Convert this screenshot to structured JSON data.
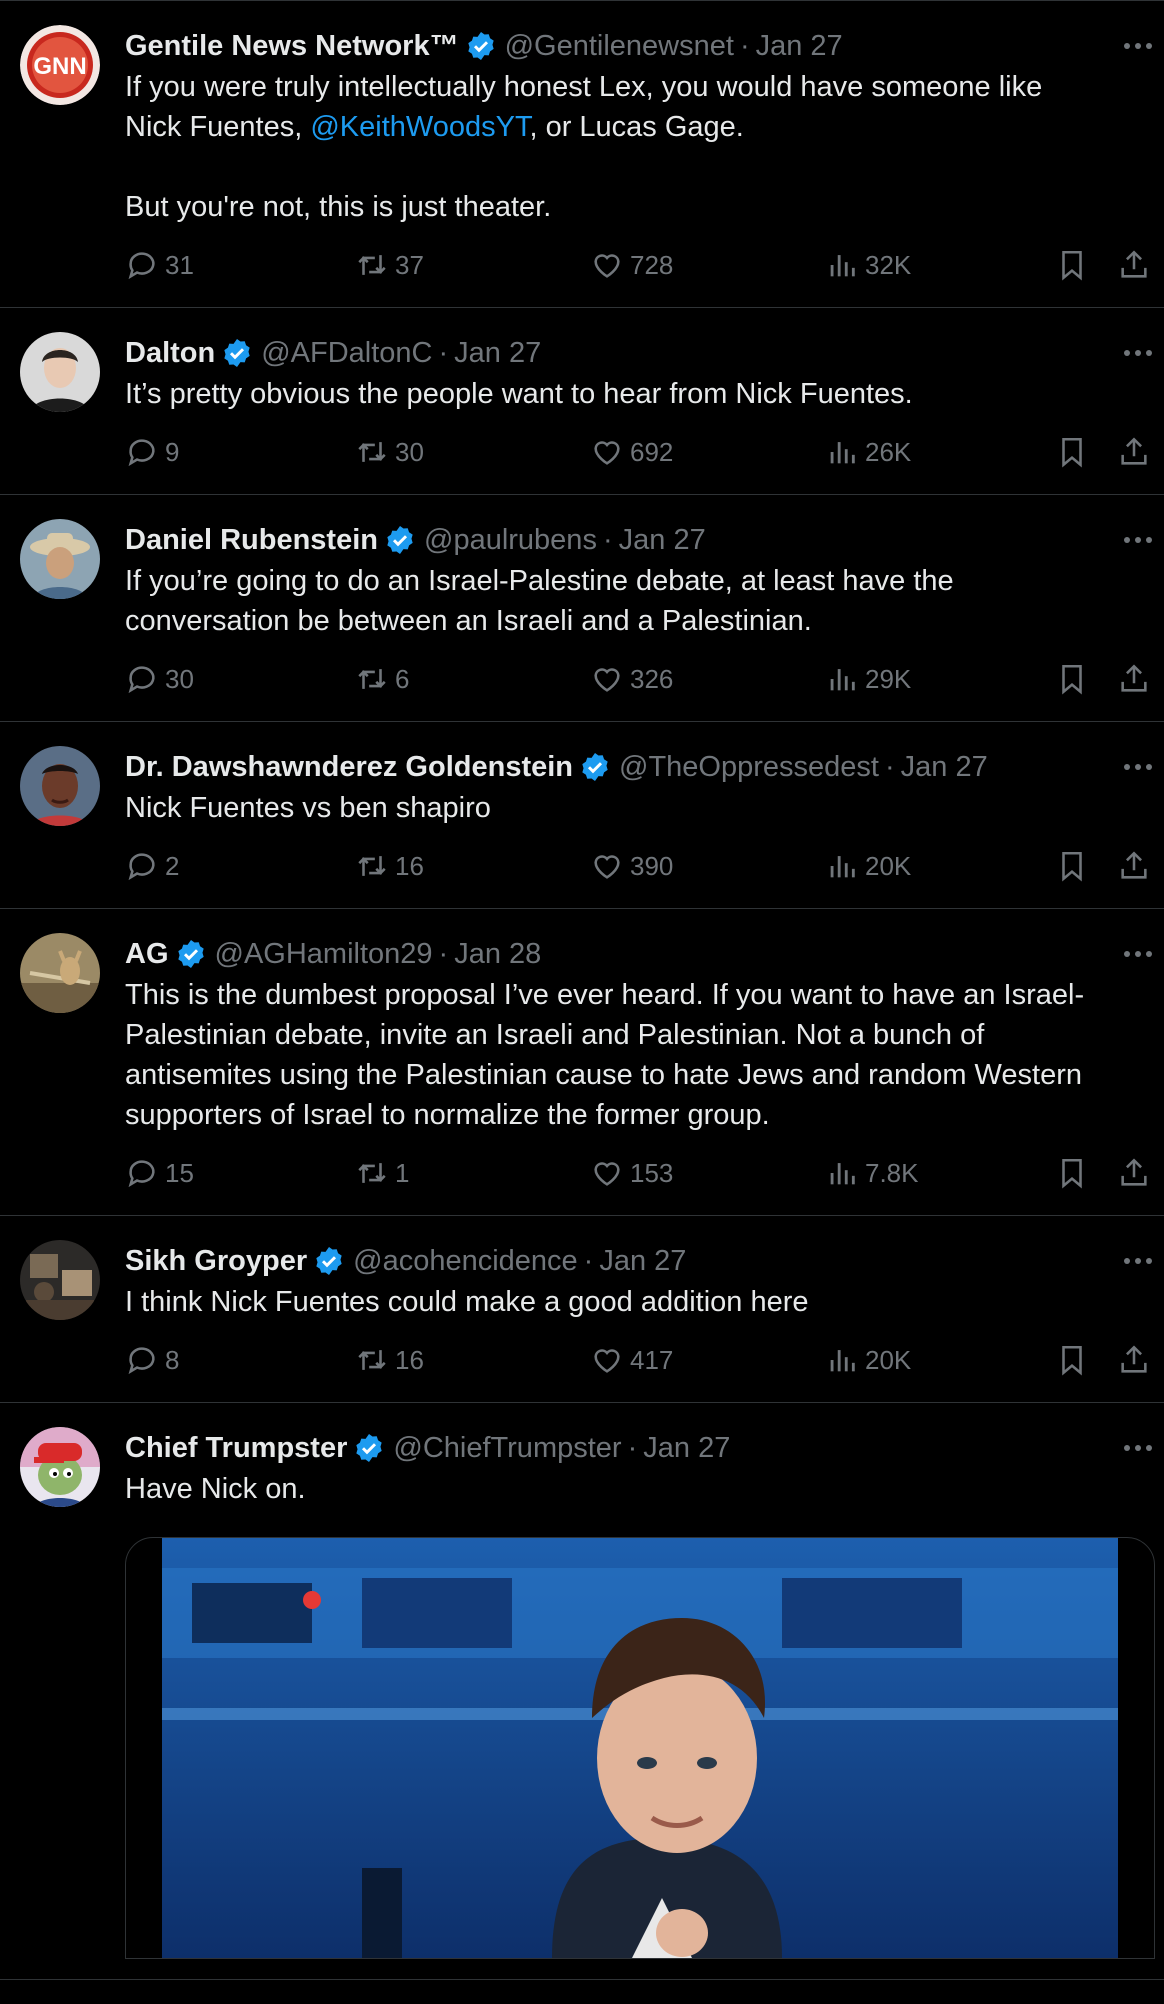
{
  "tweets": [
    {
      "name": "Gentile News Network™",
      "handle": "@Gentilenewsnet",
      "date": "Jan 27",
      "avatar": "GNN",
      "text_pre": "If you were truly intellectually honest Lex, you would have someone like\nNick Fuentes, ",
      "mention": "@KeithWoodsYT",
      "text_post": ", or Lucas Gage.\n\nBut you're not, this is just theater.",
      "replies": "31",
      "reposts": "37",
      "likes": "728",
      "views": "32K"
    },
    {
      "name": "Dalton",
      "handle": "@AFDaltonC",
      "date": "Jan 27",
      "text": "It’s pretty obvious the people want to hear from Nick Fuentes.",
      "replies": "9",
      "reposts": "30",
      "likes": "692",
      "views": "26K"
    },
    {
      "name": "Daniel Rubenstein",
      "handle": "@paulrubens",
      "date": "Jan 27",
      "text": "If you’re going to do an Israel-Palestine debate, at least have the\nconversation be between an Israeli and a Palestinian.",
      "replies": "30",
      "reposts": "6",
      "likes": "326",
      "views": "29K"
    },
    {
      "name": "Dr. Dawshawnderez Goldenstein",
      "handle": "@TheOppressedest",
      "date": "Jan 27",
      "text": "Nick Fuentes vs ben shapiro",
      "replies": "2",
      "reposts": "16",
      "likes": "390",
      "views": "20K"
    },
    {
      "name": "AG",
      "handle": "@AGHamilton29",
      "date": "Jan 28",
      "text": "This is the dumbest proposal I’ve ever heard. If you want to have an Israel-\nPalestinian debate, invite an Israeli and Palestinian. Not a bunch of\nantisemites using the Palestinian cause to hate Jews and random Western\nsupporters of Israel to normalize the former group.",
      "replies": "15",
      "reposts": "1",
      "likes": "153",
      "views": "7.8K"
    },
    {
      "name": "Sikh Groyper",
      "handle": "@acohencidence",
      "date": "Jan 27",
      "text": "I think Nick Fuentes could make a good addition here",
      "replies": "8",
      "reposts": "16",
      "likes": "417",
      "views": "20K"
    },
    {
      "name": "Chief Trumpster",
      "handle": "@ChiefTrumpster",
      "date": "Jan 27",
      "text": "Have Nick on."
    }
  ],
  "colors": {
    "accent": "#1d9bf0",
    "muted": "#71767b",
    "text": "#e7e9ea",
    "divider": "#2f3336"
  },
  "icons": [
    "reply-icon",
    "repost-icon",
    "like-icon",
    "views-icon",
    "bookmark-icon",
    "share-icon",
    "more-icon",
    "verified-icon"
  ]
}
